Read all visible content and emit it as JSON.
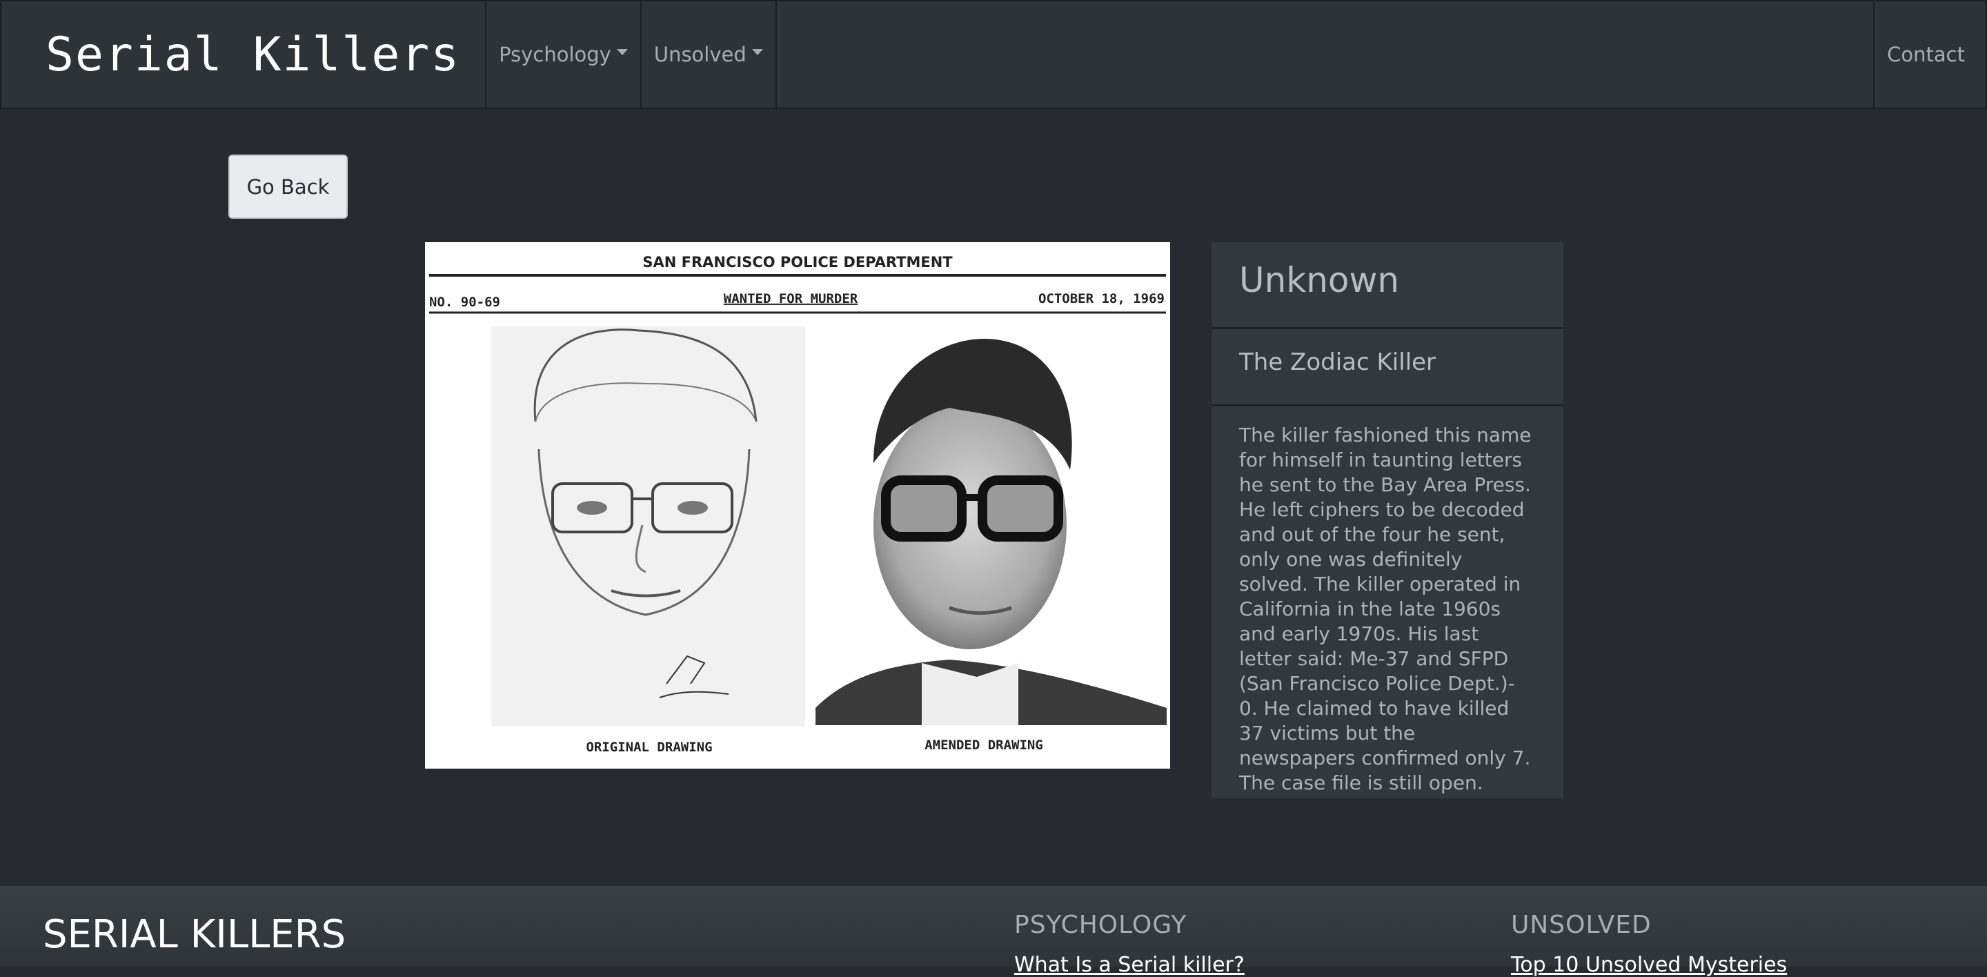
{
  "navbar": {
    "brand": "Serial Killers",
    "items": [
      {
        "label": "Psychology"
      },
      {
        "label": "Unsolved"
      }
    ],
    "right": "Contact"
  },
  "go_back_label": "Go Back",
  "poster": {
    "header": "SAN FRANCISCO POLICE DEPARTMENT",
    "number": "NO. 90-69",
    "wanted": "WANTED FOR MURDER",
    "date": "OCTOBER 18, 1969",
    "caption_left": "ORIGINAL DRAWING",
    "caption_right": "AMENDED DRAWING"
  },
  "card": {
    "title": "Unknown",
    "subtitle": "The Zodiac Killer",
    "body": "The killer fashioned this name for himself in taunting letters he sent to the Bay Area Press. He left ciphers to be decoded and out of the four he sent, only one was definitely solved. The killer operated in California in the late 1960s and early 1970s. His last letter said: Me-37 and SFPD (San Francisco Police Dept.)- 0. He claimed to have killed 37 victims but the newspapers confirmed only 7. The case file is still open."
  },
  "footer": {
    "brand": "SERIAL KILLERS",
    "columns": [
      {
        "heading": "PSYCHOLOGY",
        "link": "What Is a Serial killer?"
      },
      {
        "heading": "UNSOLVED",
        "link": "Top 10 Unsolved Mysteries"
      }
    ]
  }
}
